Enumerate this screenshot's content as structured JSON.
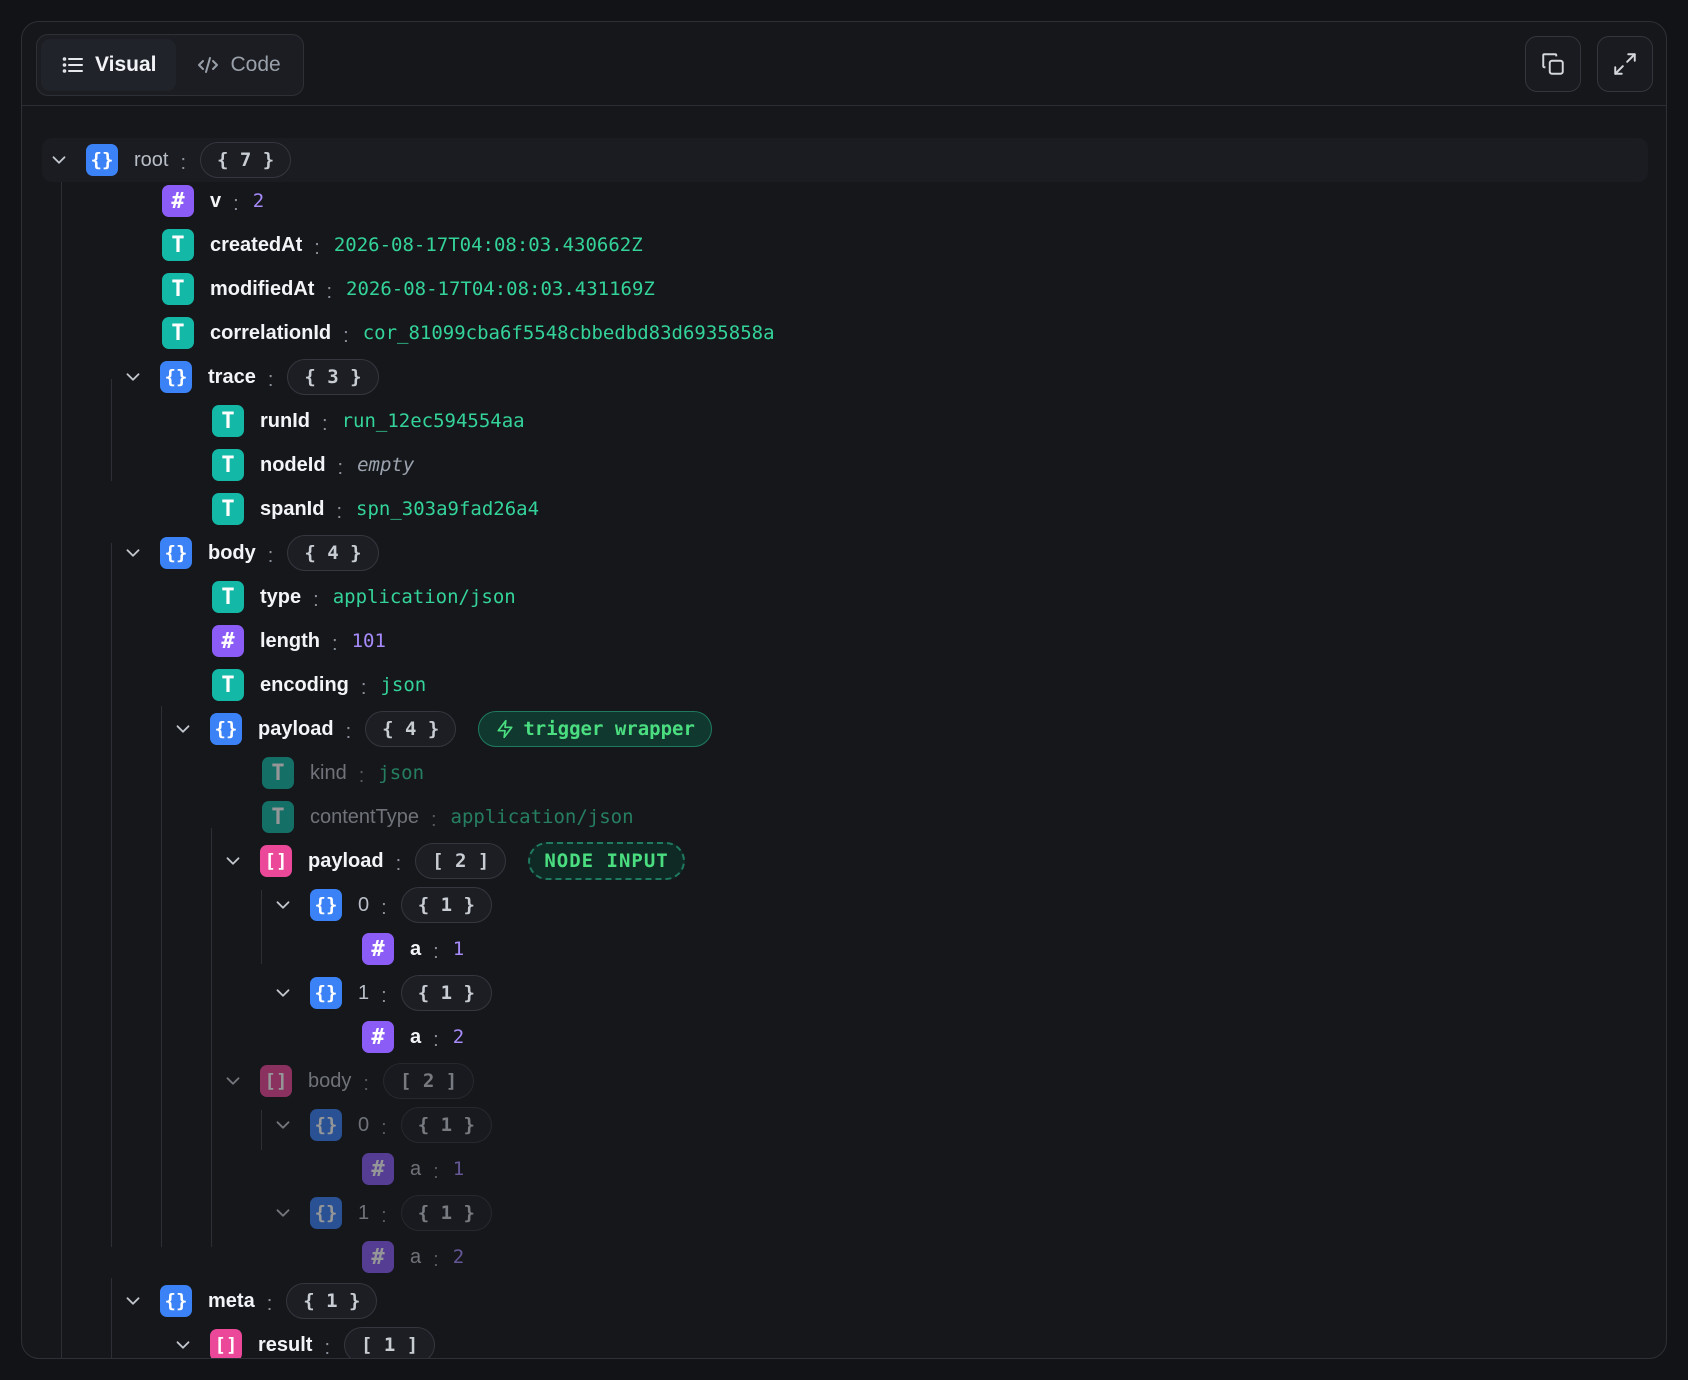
{
  "tabs": [
    {
      "label": "Visual",
      "active": true,
      "icon": "list-icon"
    },
    {
      "label": "Code",
      "active": false,
      "icon": "code-icon"
    }
  ],
  "actions": {
    "copy_icon": "copy-icon",
    "expand_icon": "expand-icon"
  },
  "colors": {
    "object": "#3b82f6",
    "number": "#8b5cf6",
    "string": "#14b8a6",
    "array": "#ec4899",
    "string_value": "#34d399",
    "number_value": "#a78bfa"
  },
  "tree": {
    "root": {
      "key": "root",
      "count": "{ 7 }"
    },
    "v": {
      "key": "v",
      "value": "2"
    },
    "createdAt": {
      "key": "createdAt",
      "value": "2026-08-17T04:08:03.430662Z"
    },
    "modifiedAt": {
      "key": "modifiedAt",
      "value": "2026-08-17T04:08:03.431169Z"
    },
    "correlationId": {
      "key": "correlationId",
      "value": "cor_81099cba6f5548cbbedbd83d6935858a"
    },
    "trace": {
      "key": "trace",
      "count": "{ 3 }"
    },
    "runId": {
      "key": "runId",
      "value": "run_12ec594554aa"
    },
    "nodeId": {
      "key": "nodeId",
      "value": "empty"
    },
    "spanId": {
      "key": "spanId",
      "value": "spn_303a9fad26a4"
    },
    "body": {
      "key": "body",
      "count": "{ 4 }"
    },
    "type": {
      "key": "type",
      "value": "application/json"
    },
    "length": {
      "key": "length",
      "value": "101"
    },
    "encoding": {
      "key": "encoding",
      "value": "json"
    },
    "payload": {
      "key": "payload",
      "count": "{ 4 }",
      "badge": "trigger wrapper"
    },
    "kind": {
      "key": "kind",
      "value": "json"
    },
    "contentType": {
      "key": "contentType",
      "value": "application/json"
    },
    "payload_arr": {
      "key": "payload",
      "count": "[ 2 ]",
      "badge": "NODE INPUT"
    },
    "p0": {
      "key": "0",
      "count": "{ 1 }"
    },
    "p0a": {
      "key": "a",
      "value": "1"
    },
    "p1": {
      "key": "1",
      "count": "{ 1 }"
    },
    "p1a": {
      "key": "a",
      "value": "2"
    },
    "body_arr": {
      "key": "body",
      "count": "[ 2 ]"
    },
    "b0": {
      "key": "0",
      "count": "{ 1 }"
    },
    "b0a": {
      "key": "a",
      "value": "1"
    },
    "b1": {
      "key": "1",
      "count": "{ 1 }"
    },
    "b1a": {
      "key": "a",
      "value": "2"
    },
    "meta": {
      "key": "meta",
      "count": "{ 1 }"
    },
    "result": {
      "key": "result",
      "count": "[ 1 ]"
    }
  }
}
